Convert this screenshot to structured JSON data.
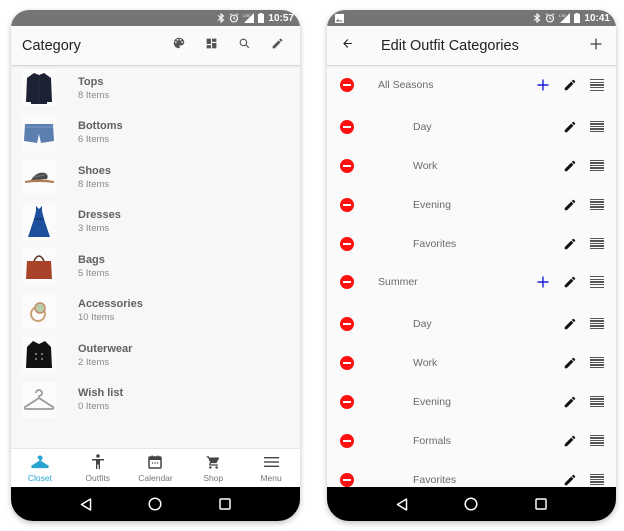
{
  "left_screen": {
    "status_bar": {
      "icons": [
        "bluetooth-icon",
        "alarm-icon",
        "signal-lte-icon",
        "battery-icon"
      ],
      "time": "10:57"
    },
    "app_bar": {
      "title": "Category",
      "actions": [
        "palette-icon",
        "dashboard-icon",
        "search-icon",
        "edit-pencil-icon"
      ]
    },
    "categories": [
      {
        "name": "Tops",
        "count": "8 Items",
        "thumbnail": "jacket-navy"
      },
      {
        "name": "Bottoms",
        "count": "6 Items",
        "thumbnail": "denim-shorts"
      },
      {
        "name": "Shoes",
        "count": "8 Items",
        "thumbnail": "sandal"
      },
      {
        "name": "Dresses",
        "count": "3 Items",
        "thumbnail": "blue-dress"
      },
      {
        "name": "Bags",
        "count": "5 Items",
        "thumbnail": "brown-handbag"
      },
      {
        "name": "Accessories",
        "count": "10 Items",
        "thumbnail": "ring"
      },
      {
        "name": "Outerwear",
        "count": "2 Items",
        "thumbnail": "black-peacoat"
      },
      {
        "name": "Wish list",
        "count": "0 Items",
        "thumbnail": "hanger-icon"
      }
    ],
    "bottom_nav": [
      {
        "label": "Closet",
        "icon": "hanger-icon",
        "active": true
      },
      {
        "label": "Outfits",
        "icon": "person-icon",
        "active": false
      },
      {
        "label": "Calendar",
        "icon": "calendar-icon",
        "active": false
      },
      {
        "label": "Shop",
        "icon": "cart-icon",
        "active": false
      },
      {
        "label": "Menu",
        "icon": "menu-icon",
        "active": false
      }
    ],
    "accent_color": "#29a3d4"
  },
  "right_screen": {
    "status_bar": {
      "icons": [
        "image-notification-icon",
        "bluetooth-icon",
        "alarm-icon",
        "signal-lte-icon",
        "battery-icon"
      ],
      "time": "10:41"
    },
    "app_bar": {
      "title": "Edit Outfit Categories",
      "back_icon": "arrow-back-icon",
      "add_icon": "plus-icon"
    },
    "groups": [
      {
        "name": "All Seasons",
        "children": [
          "Day",
          "Work",
          "Evening",
          "Favorites"
        ]
      },
      {
        "name": "Summer",
        "children": [
          "Day",
          "Work",
          "Evening",
          "Formals",
          "Favorites"
        ]
      }
    ],
    "remove_color": "#ff1010",
    "add_color": "#1a1adc"
  },
  "system_nav": [
    "back-triangle-icon",
    "home-circle-icon",
    "recents-square-icon"
  ]
}
